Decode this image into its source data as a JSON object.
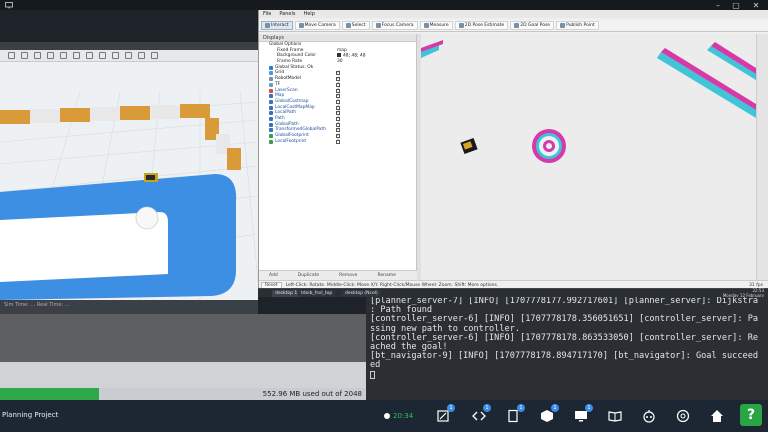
{
  "top_bar": {
    "icons": [
      "monitor-icon",
      "minimize-icon",
      "maximize-icon",
      "close-icon"
    ]
  },
  "gazebo": {
    "title": "",
    "status_text": "Sim Time: ... Real Time: ..."
  },
  "rviz": {
    "menu": [
      "File",
      "Panels",
      "Help"
    ],
    "tools": [
      {
        "label": "Interact",
        "active": true
      },
      {
        "label": "Move Camera"
      },
      {
        "label": "Select"
      },
      {
        "label": "Focus Camera"
      },
      {
        "label": "Measure"
      },
      {
        "label": "2D Pose Estimate"
      },
      {
        "label": "2D Goal Pose"
      },
      {
        "label": "Publish Point"
      }
    ],
    "displays_title": "Displays",
    "global_options": {
      "label": "Global Options",
      "fixed_frame_label": "Fixed Frame",
      "fixed_frame_value": "map",
      "bg_color_label": "Background Color",
      "bg_color_value": "48; 48; 48",
      "frame_rate_label": "Frame Rate",
      "frame_rate_value": "30"
    },
    "displays": [
      {
        "label": "Global Status: Ok",
        "checked": false
      },
      {
        "label": "Grid",
        "checked": true
      },
      {
        "label": "RobotModel",
        "checked": true
      },
      {
        "label": "TF",
        "checked": true
      },
      {
        "label": "LaserScan",
        "checked": true
      },
      {
        "label": "Map",
        "checked": true
      },
      {
        "label": "GlobalCostmap",
        "checked": true
      },
      {
        "label": "LocalCostMapMap",
        "checked": true
      },
      {
        "label": "LocalPath",
        "checked": true
      },
      {
        "label": "Path",
        "checked": true
      },
      {
        "label": "GlobalPath",
        "checked": true
      },
      {
        "label": "TransformedGlobalPath",
        "checked": true
      },
      {
        "label": "GlobalFootprint",
        "checked": true
      },
      {
        "label": "LocalFootprint",
        "checked": true
      }
    ],
    "display_buttons": [
      "Add",
      "Duplicate",
      "Remove",
      "Rename"
    ],
    "status_bar": {
      "reset": "Reset",
      "help": "Left-Click: Rotate. Middle-Click: Move X/Y. Right-Click/Mouse Wheel: Zoom. Shift: More options.",
      "fps": "31 fps"
    }
  },
  "taskbar": {
    "items": [
      "desktop 1",
      "tdoib_fsvl_top",
      "desktop (Ncel)"
    ],
    "clock_time": "22:53",
    "clock_date": "Monday 12 February"
  },
  "terminal": {
    "lines": [
      "[planner_server-7] [INFO] [1707778177.992717601] [planner_server]: Dijkstra",
      ": Path found",
      "[controller_server-6] [INFO] [1707778178.356051651] [controller_server]: Pa",
      "ssing new path to controller.",
      "[controller_server-6] [INFO] [1707778178.863533050] [controller_server]: Re",
      "ached the goal!",
      "[bt_navigator-9] [INFO] [1707778178.894717170] [bt_navigator]: Goal succeed",
      "ed"
    ]
  },
  "memory": {
    "text": "552.96 MB used out of 2048",
    "fraction": 0.27
  },
  "bottom": {
    "title": "Planning Project",
    "timer": "20:34",
    "badges": [
      "1",
      "1",
      "1",
      "1",
      "1"
    ]
  },
  "colors": {
    "accent_green": "#2aa545",
    "costmap_magenta": "#d63aa8",
    "costmap_cyan": "#38c6d8"
  }
}
